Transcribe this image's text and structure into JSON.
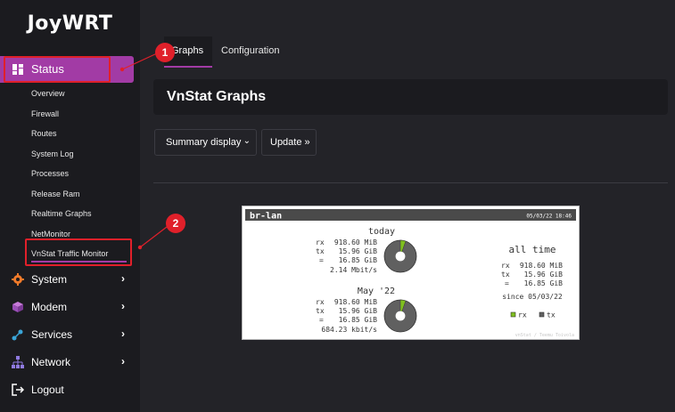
{
  "brand": {
    "logo_text": "JoyWRT"
  },
  "sidebar": {
    "status_label": "Status",
    "status_items": [
      "Overview",
      "Firewall",
      "Routes",
      "System Log",
      "Processes",
      "Release Ram",
      "Realtime Graphs",
      "NetMonitor",
      "VnStat Traffic Monitor"
    ],
    "main_items": [
      {
        "label": "System",
        "icon": "gear-icon"
      },
      {
        "label": "Modem",
        "icon": "cube-icon"
      },
      {
        "label": "Services",
        "icon": "services-icon"
      },
      {
        "label": "Network",
        "icon": "network-icon"
      },
      {
        "label": "Logout",
        "icon": "logout-icon"
      }
    ]
  },
  "tabs": {
    "graphs": "Graphs",
    "configuration": "Configuration"
  },
  "page": {
    "title": "VnStat Graphs",
    "select_value": "Summary display",
    "update_label": "Update »"
  },
  "annotations": {
    "badge_1": "1",
    "badge_2": "2"
  },
  "vnstat": {
    "interface": "br-lan",
    "timestamp": "05/03/22 18:46",
    "today_title": "today",
    "today_rx_label": "rx",
    "today_rx": "918.60 MiB",
    "today_tx_label": "tx",
    "today_tx": "15.96 GiB",
    "today_total_label": "=",
    "today_total": "16.85 GiB",
    "today_rate": "2.14 Mbit/s",
    "month_title": "May '22",
    "month_rx_label": "rx",
    "month_rx": "918.60 MiB",
    "month_tx_label": "tx",
    "month_tx": "15.96 GiB",
    "month_total_label": "=",
    "month_total": "16.85 GiB",
    "month_rate": "684.23 kbit/s",
    "alltime_title": "all time",
    "alltime_rx_label": "rx",
    "alltime_rx": "918.60 MiB",
    "alltime_tx_label": "tx",
    "alltime_tx": "15.96 GiB",
    "alltime_total_label": "=",
    "alltime_total": "16.85 GiB",
    "since": "since 05/03/22",
    "legend_rx": "rx",
    "legend_tx": "tx",
    "footer": "vnStat / Teemu Toivola",
    "rx_share": 0.054,
    "colors": {
      "rx": "#7fbf1f",
      "tx": "#606060"
    }
  },
  "colors": {
    "accent": "#a23ba5",
    "annotation": "#e0202a",
    "sidebar_bg": "#1b1b1f",
    "content_bg": "#232328"
  }
}
